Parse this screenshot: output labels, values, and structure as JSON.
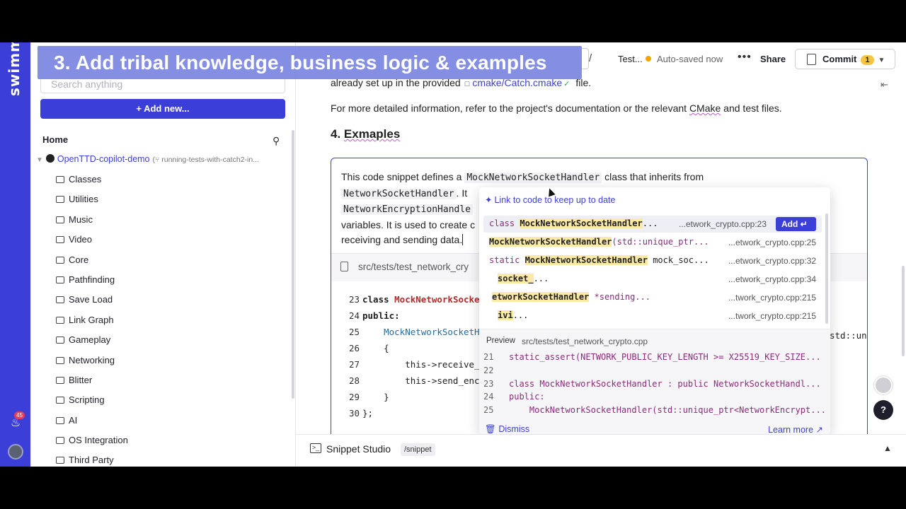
{
  "caption": "3. Add tribal knowledge, business logic & examples",
  "rail": {
    "logo": "swimm",
    "notifications": "45"
  },
  "sidebar": {
    "search_placeholder": "Search anything",
    "add_new": "+ Add new...",
    "home": "Home",
    "repo": {
      "name": "OpenTTD-copilot-demo",
      "branch": "(⑂ running-tests-with-catch2-in..."
    },
    "folders": [
      "Classes",
      "Utilities",
      "Music",
      "Video",
      "Core",
      "Pathfinding",
      "Save Load",
      "Link Graph",
      "Gameplay",
      "Networking",
      "Blitter",
      "Scripting",
      "AI",
      "OS Integration",
      "Third Party"
    ]
  },
  "topbar": {
    "separator": "/",
    "crumb": "Test...",
    "saved": "Auto-saved now",
    "more": "•••",
    "share": "Share",
    "commit": "Commit",
    "commit_count": "1"
  },
  "doc": {
    "line1_prefix": "already set up in the provided",
    "line1_link": "cmake/Catch.cmake",
    "line1_suffix": "file.",
    "para2_a": "For more detailed information, refer to the project's documentation or the relevant ",
    "para2_cmake": "CMake",
    "para2_b": " and test files.",
    "heading": "4. Exmaples",
    "heading_num": "4.",
    "heading_word": "Exmaples"
  },
  "card": {
    "text_a": "This code snippet defines a ",
    "text_code1": "MockNetworkSocketHandler",
    "text_b": " class that inherits from",
    "text_code2": "NetworkSocketHandler",
    "text_c": ". It",
    "text_code3": "NetworkEncryptionHandle",
    "text_d": "variables. It is used to create c",
    "text_e": "receiving and sending data.",
    "file": "src/tests/test_network_cry",
    "code_lines": [
      {
        "n": "23",
        "t": "class MockNetworkSocke"
      },
      {
        "n": "24",
        "t": "public:"
      },
      {
        "n": "25",
        "t": "    MockNetworkSocketH"
      },
      {
        "n": "26",
        "t": "    {"
      },
      {
        "n": "27",
        "t": "        this->receive_"
      },
      {
        "n": "28",
        "t": "        this->send_enc"
      },
      {
        "n": "29",
        "t": "    }"
      },
      {
        "n": "30",
        "t": "};"
      }
    ],
    "code_tail": "std::uni"
  },
  "popup": {
    "header": "Link to code to keep up to date",
    "add": "Add ↵",
    "results": [
      {
        "pre": "class ",
        "hl": "MockNetworkSocketHandler",
        "post": "...",
        "file": "...etwork_crypto.cpp:23"
      },
      {
        "pre": "",
        "hl": "MockNetworkSocketHandler",
        "post": "(std::unique_ptr...",
        "file": "...etwork_crypto.cpp:25"
      },
      {
        "pre": "static ",
        "hl": "MockNetworkSocketHandler",
        "post": " mock_soc...",
        "file": "...etwork_crypto.cpp:32"
      },
      {
        "pre": "",
        "hl": "socket_",
        "post": "...",
        "file": "...etwork_crypto.cpp:34"
      },
      {
        "pre": "",
        "hl": "etworkSocketHandler",
        "post": " *sending...",
        "file": "...twork_crypto.cpp:215"
      },
      {
        "pre": "",
        "hl": "ivi",
        "post": "...",
        "file": "...twork_crypto.cpp:215"
      }
    ],
    "preview_label": "Preview",
    "preview_path": "src/tests/test_network_crypto.cpp",
    "preview": [
      {
        "n": "21",
        "t": "static_assert(NETWORK_PUBLIC_KEY_LENGTH >= X25519_KEY_SIZE..."
      },
      {
        "n": "22",
        "t": ""
      },
      {
        "n": "23",
        "t": "class MockNetworkSocketHandler : public NetworkSocketHandl..."
      },
      {
        "n": "24",
        "t": "public:"
      },
      {
        "n": "25",
        "t": "    MockNetworkSocketHandler(std::unique_ptr<NetworkEncrypt..."
      }
    ],
    "dismiss": "Dismiss",
    "learn_more": "Learn more"
  },
  "snippet_studio": {
    "title": "Snippet Studio",
    "slash": "/snippet"
  },
  "help": "?"
}
